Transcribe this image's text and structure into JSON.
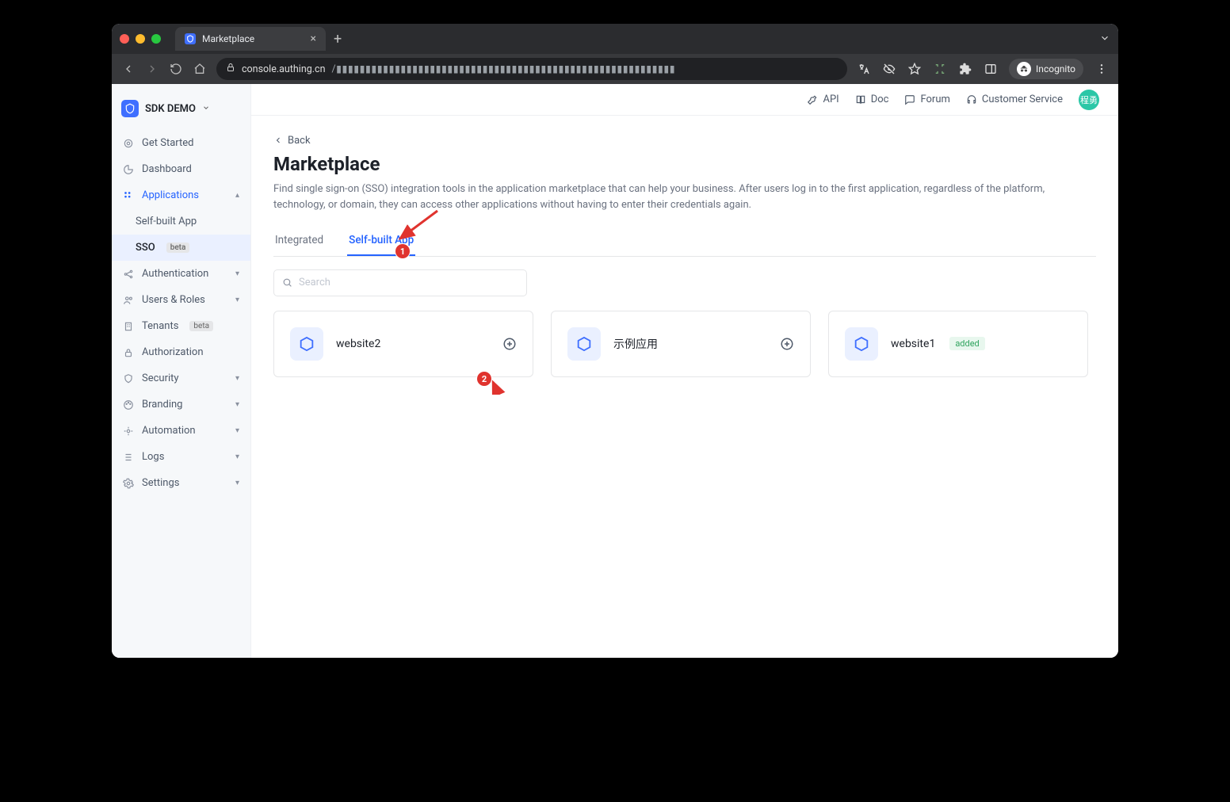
{
  "browser": {
    "tab_title": "Marketplace",
    "url_host": "console.authing.cn",
    "incognito_label": "Incognito"
  },
  "topbar": {
    "api": "API",
    "doc": "Doc",
    "forum": "Forum",
    "customer_service": "Customer Service",
    "avatar_text": "程勇"
  },
  "sidebar": {
    "workspace": "SDK DEMO",
    "items": {
      "get_started": "Get Started",
      "dashboard": "Dashboard",
      "applications": "Applications",
      "self_built": "Self-built App",
      "sso": "SSO",
      "sso_badge": "beta",
      "authentication": "Authentication",
      "users_roles": "Users & Roles",
      "tenants": "Tenants",
      "tenants_badge": "beta",
      "authorization": "Authorization",
      "security": "Security",
      "branding": "Branding",
      "automation": "Automation",
      "logs": "Logs",
      "settings": "Settings"
    }
  },
  "page": {
    "back": "Back",
    "title": "Marketplace",
    "description": "Find single sign-on (SSO) integration tools in the application marketplace that can help your business. After users log in to the first application, regardless of the platform, technology, or domain, they can access other applications without having to enter their credentials again.",
    "tabs": {
      "integrated": "Integrated",
      "self_built": "Self-built App"
    },
    "search_placeholder": "Search"
  },
  "apps": [
    {
      "name": "website2",
      "added": false
    },
    {
      "name": "示例应用",
      "added": false
    },
    {
      "name": "website1",
      "added": true,
      "added_label": "added"
    }
  ],
  "annotations": {
    "one": "1",
    "two": "2"
  }
}
